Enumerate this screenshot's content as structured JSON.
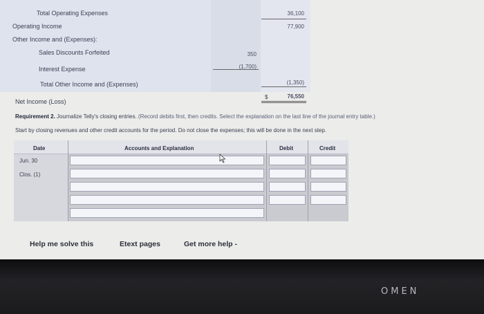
{
  "income_statement": {
    "total_operating_expenses": {
      "label": "Total Operating Expenses",
      "amount": "36,100"
    },
    "operating_income": {
      "label": "Operating Income",
      "amount": "77,900"
    },
    "other_income_header": "Other Income and (Expenses):",
    "sales_discounts": {
      "label": "Sales Discounts Forfeited",
      "amount": "350"
    },
    "interest_expense": {
      "label": "Interest Expense",
      "amount": "(1,700)"
    },
    "total_other": {
      "label": "Total Other Income and (Expenses)",
      "amount": "(1,350)"
    },
    "net_income": {
      "label": "Net Income (Loss)",
      "currency": "$",
      "amount": "76,550"
    }
  },
  "requirement": {
    "title": "Requirement 2.",
    "text": "Journalize Telly's closing entries.",
    "note": "(Record debits first, then credits. Select the explanation on the last line of the journal entry table.)",
    "instruction": "Start by closing revenues and other credit accounts for the period. Do not close the expenses; this will be done in the next step."
  },
  "journal_table": {
    "headers": {
      "date": "Date",
      "accounts": "Accounts and Explanation",
      "debit": "Debit",
      "credit": "Credit"
    },
    "date_lines": [
      "Jun. 30",
      "Clos. (1)"
    ],
    "row_count": 5
  },
  "footer_links": {
    "help": "Help me solve this",
    "etext": "Etext pages",
    "more_help": "Get more help -"
  },
  "monitor_brand": "OMEN",
  "colors": {
    "band": "#dfe3ee",
    "screen": "#ececea",
    "bezel": "#1c1c1f"
  }
}
